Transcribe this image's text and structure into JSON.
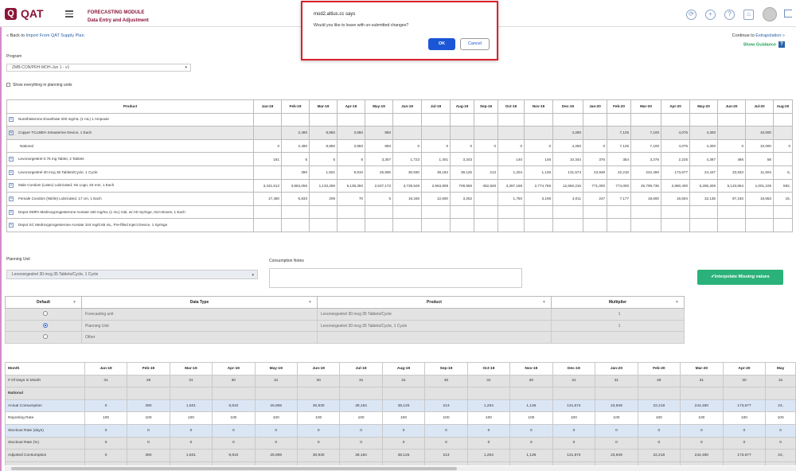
{
  "header": {
    "logo_text": "QAT",
    "logo_letter": "Q",
    "module_line1": "FORECASTING MODULE",
    "module_line2": "Data Entry and Adjustment",
    "icons": [
      "user-sync-icon",
      "plus-circle-icon",
      "help-icon",
      "home-icon",
      "avatar",
      "logout-icon"
    ]
  },
  "dialog": {
    "site": "mod2.altius.cc says",
    "message": "Would you like to leave with un-submitted changes?",
    "ok_label": "OK",
    "cancel_label": "Cancel"
  },
  "nav": {
    "back_prefix": "« Back to ",
    "back_link": "Import From QAT Supply Plan",
    "continue_prefix": "Continue to ",
    "continue_link": "Extrapolation »",
    "guidance_label": "Show Guidance",
    "guidance_icon": "?"
  },
  "filters": {
    "program_label": "Program",
    "program_value": "ZMB-CON/PRH-MOH-Jun 1 - v1",
    "show_all_label": "Show everything in planning units"
  },
  "product_grid": {
    "headers": [
      "Product",
      "Jan-19",
      "Feb-19",
      "Mar-19",
      "Apr-19",
      "May-19",
      "Jun-19",
      "Jul-19",
      "Aug-19",
      "Sep-19",
      "Oct-19",
      "Nov-19",
      "Dec-19",
      "Jan-20",
      "Feb-20",
      "Mar-20",
      "Apr-20",
      "May-20",
      "Jun-20",
      "Jul-20",
      "Aug-20"
    ],
    "rows": [
      {
        "expand": true,
        "hl": false,
        "cells": [
          "Norethisterone Enanthate 200 mg/mL (1 mL) 1 Ampoule",
          "",
          "",
          "",
          "",
          "",
          "",
          "",
          "",
          "",
          "",
          "",
          "",
          "",
          "",
          "",
          "",
          "",
          "",
          "",
          ""
        ]
      },
      {
        "expand": true,
        "hl": true,
        "cells": [
          "Copper TCu380A Intrauterine Device, 1 Each",
          "",
          "2,480",
          "8,850",
          "3,850",
          "850",
          "",
          "",
          "",
          "",
          "",
          "",
          "4,280",
          "",
          "7,125",
          "7,100",
          "4,075",
          "4,300",
          "",
          "10,000",
          ""
        ]
      },
      {
        "expand": false,
        "hl": false,
        "cells": [
          "National",
          "0",
          "2,480",
          "8,850",
          "3,850",
          "850",
          "0",
          "0",
          "0",
          "0",
          "0",
          "0",
          "4,280",
          "0",
          "7,125",
          "7,100",
          "4,075",
          "4,300",
          "0",
          "10,000",
          "0"
        ]
      },
      {
        "expand": true,
        "hl": false,
        "cells": [
          "Levonorgestrel 0.75 mg Tablet, 2 Tablets",
          "181",
          "5",
          "5",
          "6",
          "3,307",
          "1,723",
          "1,401",
          "3,343",
          "",
          "140",
          "146",
          "10,344",
          "376",
          "354",
          "3,276",
          "2,225",
          "4,387",
          "486",
          "58",
          ""
        ]
      },
      {
        "expand": true,
        "hl": false,
        "cells": [
          "Levonorgestrel 30 mcg 35 Tablets/Cycle, 1 Cycle",
          "",
          "390",
          "1,501",
          "9,910",
          "25,906",
          "30,930",
          "38,184",
          "38,125",
          "213",
          "1,204",
          "1,136",
          "131,574",
          "23,949",
          "22,218",
          "242,490",
          "173,677",
          "24,447",
          "33,933",
          "11,504",
          "6,"
        ]
      },
      {
        "expand": true,
        "hl": false,
        "cells": [
          "Male Condom (Latex) Lubricated, No Logo, 53 mm, 1 Each",
          "3,431,612",
          "3,884,056",
          "1,133,296",
          "6,138,350",
          "2,537,172",
          "3,739,528",
          "2,963,808",
          "709,956",
          "452,928",
          "3,367,168",
          "2,774,768",
          "12,650,216",
          "771,000",
          "774,000",
          "26,799,736",
          "2,980,400",
          "5,285,306",
          "5,133,864",
          "1,001,106",
          "592,"
        ]
      },
      {
        "expand": true,
        "hl": false,
        "cells": [
          "Female Condom (Nitrile) Lubricated, 17 cm, 1 Each",
          "17,450",
          "6,833",
          "209",
          "70",
          "5",
          "16,348",
          "12,600",
          "3,262",
          "",
          "1,750",
          "3,108",
          "4,011",
          "247",
          "7,177",
          "18,600",
          "16,504",
          "32,135",
          "97,193",
          "18,653",
          "15,"
        ]
      },
      {
        "expand": true,
        "hl": false,
        "cells": [
          "Depot DMPA Medroxyprogesterone Acetate 150 mg/mL (1 mL) Vial, w/ AD Syringe, 0cm Boxes, 1 Each",
          "",
          "",
          "",
          "",
          "",
          "",
          "",
          "",
          "",
          "",
          "",
          "",
          "",
          "",
          "",
          "",
          "",
          "",
          "",
          ""
        ]
      },
      {
        "expand": true,
        "hl": false,
        "cells": [
          "Depot SC Medroxyprogesterone Acetate 104 mg/0.65 mL, Pre-filled Inject Device, 1 Syringe",
          "",
          "",
          "",
          "",
          "",
          "",
          "",
          "",
          "",
          "",
          "",
          "",
          "",
          "",
          "",
          "",
          "",
          "",
          "",
          ""
        ]
      }
    ]
  },
  "detail": {
    "planning_unit_label": "Planning Unit",
    "planning_unit_value": "Levonorgestrel 30 mcg 35 Tablets/Cycle, 1 Cycle",
    "notes_label": "Consumption Notes",
    "interpolate_label": "✔Interpolate Missing values"
  },
  "datatype_grid": {
    "headers": [
      "Default",
      "Data Type",
      "Product",
      "Multiplier"
    ],
    "rows": [
      {
        "selected": false,
        "type": "Forecasting unit",
        "product": "Levonorgestrel 30 mcg 35 Tablets/Cycle",
        "multiplier": "1"
      },
      {
        "selected": true,
        "type": "Planning Unit",
        "product": "Levonorgestrel 30 mcg 35 Tablets/Cycle, 1 Cycle",
        "multiplier": "1"
      },
      {
        "selected": false,
        "type": "Other",
        "product": "",
        "multiplier": ""
      }
    ]
  },
  "consumption_grid": {
    "header": [
      "Month",
      "Jan-19",
      "Feb-19",
      "Mar-19",
      "Apr-19",
      "May-19",
      "Jun-19",
      "Jul-19",
      "Aug-19",
      "Sep-19",
      "Oct-19",
      "Nov-19",
      "Dec-19",
      "Jan-20",
      "Feb-20",
      "Mar-20",
      "Apr-20",
      "May"
    ],
    "rows": [
      {
        "style": "grey",
        "cells": [
          "# Of Days in Month",
          "31",
          "28",
          "31",
          "30",
          "31",
          "30",
          "31",
          "31",
          "30",
          "31",
          "30",
          "31",
          "31",
          "28",
          "31",
          "30",
          "31"
        ]
      },
      {
        "style": "section",
        "cells": [
          "National",
          "",
          "",
          "",
          "",
          "",
          "",
          "",
          "",
          "",
          "",
          "",
          "",
          "",
          "",
          "",
          "",
          ""
        ]
      },
      {
        "style": "blue",
        "cells": [
          "Actual Consumption",
          "0",
          "390",
          "1,501",
          "9,910",
          "25,906",
          "30,930",
          "38,184",
          "38,125",
          "213",
          "1,204",
          "1,136",
          "131,574",
          "23,949",
          "22,218",
          "242,490",
          "173,677",
          "24,"
        ]
      },
      {
        "style": "white",
        "cells": [
          "Reporting Rate",
          "100",
          "100",
          "100",
          "100",
          "100",
          "100",
          "100",
          "100",
          "100",
          "100",
          "100",
          "100",
          "100",
          "100",
          "100",
          "100",
          "100"
        ]
      },
      {
        "style": "blue",
        "cells": [
          "Stockout Rate (days)",
          "0",
          "0",
          "0",
          "0",
          "0",
          "0",
          "0",
          "0",
          "0",
          "0",
          "0",
          "0",
          "0",
          "0",
          "0",
          "0",
          "0"
        ]
      },
      {
        "style": "grey",
        "cells": [
          "Stockout Rate (%)",
          "0",
          "0",
          "0",
          "0",
          "0",
          "0",
          "0",
          "0",
          "0",
          "0",
          "0",
          "0",
          "0",
          "0",
          "0",
          "0",
          "0"
        ]
      },
      {
        "style": "grey",
        "cells": [
          "Adjusted Consumption",
          "0",
          "390",
          "1,501",
          "9,910",
          "25,906",
          "30,930",
          "38,184",
          "38,125",
          "213",
          "1,204",
          "1,136",
          "131,574",
          "23,949",
          "22,218",
          "242,490",
          "173,677",
          "24,"
        ]
      },
      {
        "style": "grey",
        "cells": [
          "Converted to Planning Unit",
          "0",
          "390",
          "1,501",
          "9,910",
          "25,906",
          "30,930",
          "38,184",
          "38,125",
          "213",
          "1,204",
          "1,136",
          "131,574",
          "23,949",
          "22,218",
          "242,490",
          "173,677",
          "24,"
        ]
      }
    ]
  },
  "colors": {
    "brand": "#8a1538",
    "link": "#2a62a8",
    "success": "#2ab27a",
    "dialog_border": "#d9212a",
    "dialog_ok": "#1a56d6"
  }
}
